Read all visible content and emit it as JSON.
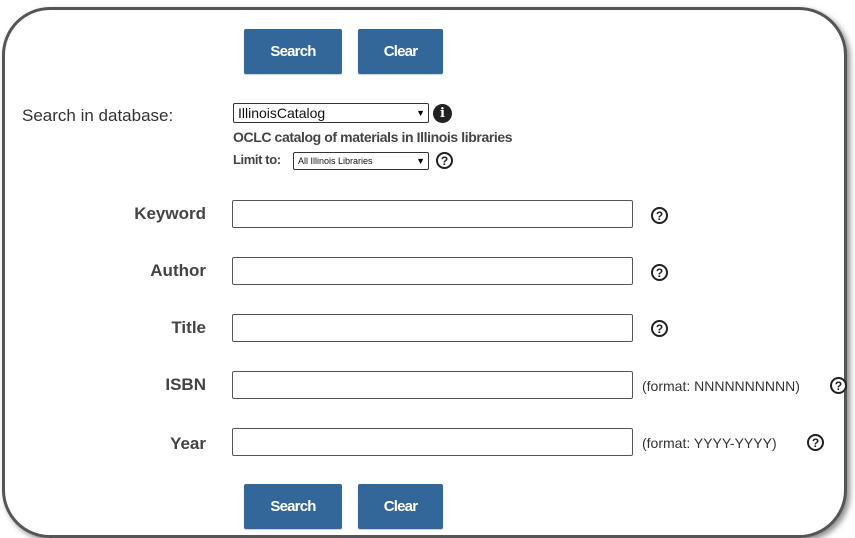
{
  "top_buttons": {
    "search": "Search",
    "clear": "Clear"
  },
  "bottom_buttons": {
    "search": "Search",
    "clear": "Clear"
  },
  "database": {
    "label": "Search in database:",
    "selected": "IllinoisCatalog",
    "description": "OCLC catalog of materials in Illinois libraries",
    "limit_label": "Limit to:",
    "limit_selected": "All Illinois Libraries"
  },
  "fields": {
    "keyword": {
      "label": "Keyword",
      "value": ""
    },
    "author": {
      "label": "Author",
      "value": ""
    },
    "title": {
      "label": "Title",
      "value": ""
    },
    "isbn": {
      "label": "ISBN",
      "value": "",
      "format": "(format: NNNNNNNNNN)"
    },
    "year": {
      "label": "Year",
      "value": "",
      "format": "(format: YYYY-YYYY)"
    }
  },
  "icons": {
    "help": "?",
    "info": "i"
  },
  "colors": {
    "button_bg": "#336699",
    "button_text": "#ffffff"
  }
}
